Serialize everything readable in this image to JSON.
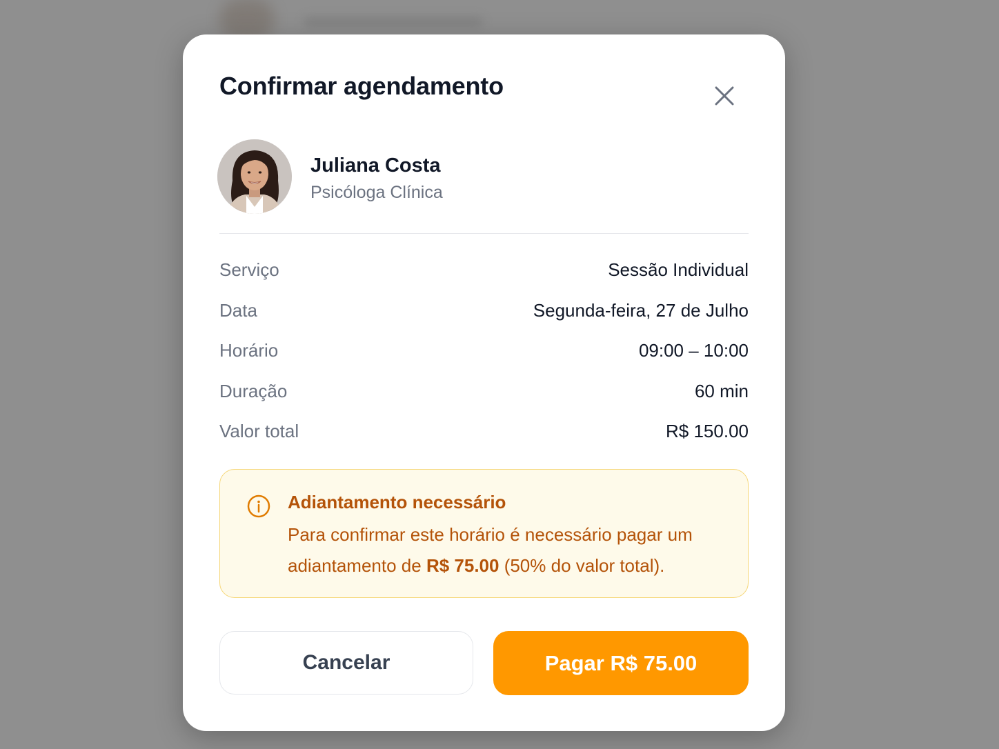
{
  "dialog": {
    "title": "Confirmar agendamento"
  },
  "professional": {
    "name": "Juliana Costa",
    "role": "Psicóloga Clínica"
  },
  "details": [
    {
      "label": "Serviço",
      "value": "Sessão Individual"
    },
    {
      "label": "Data",
      "value": "Segunda-feira, 27 de Julho"
    },
    {
      "label": "Horário",
      "value": "09:00 – 10:00"
    },
    {
      "label": "Duração",
      "value": "60 min"
    },
    {
      "label": "Valor total",
      "value": "R$ 150.00"
    }
  ],
  "notice": {
    "title": "Adiantamento necessário",
    "text_before": "Para confirmar este horário é necessário pagar um adiantamento de ",
    "amount": "R$ 75.00",
    "text_after": " (50% do valor total)."
  },
  "actions": {
    "cancel_label": "Cancelar",
    "pay_label": "Pagar R$ 75.00"
  },
  "colors": {
    "accent": "#ff9800",
    "notice_text": "#b45309",
    "notice_bg": "#fefaea",
    "notice_border": "#f6d77a"
  },
  "icons": {
    "close": "close-icon",
    "info": "info-icon",
    "avatar": "avatar"
  }
}
